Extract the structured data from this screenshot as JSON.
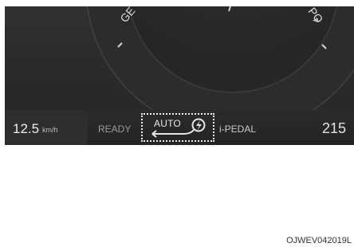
{
  "cluster": {
    "gauge_labels": {
      "left_partial": "GE",
      "right_partial": "PO"
    },
    "info_bar": {
      "speed_value": "12.5",
      "speed_unit": "km/h",
      "ready_label": "READY",
      "auto_label": "AUTO",
      "auto_icon": "regen-lightning-arrow-icon",
      "ipedal_label": "i-PEDAL",
      "range_value": "215"
    }
  },
  "figure_code": "OJWEV042019L",
  "colors": {
    "cluster_bg": "#2a2a2a",
    "text_light": "#ededed",
    "highlight_border": "#f0f0f0"
  }
}
